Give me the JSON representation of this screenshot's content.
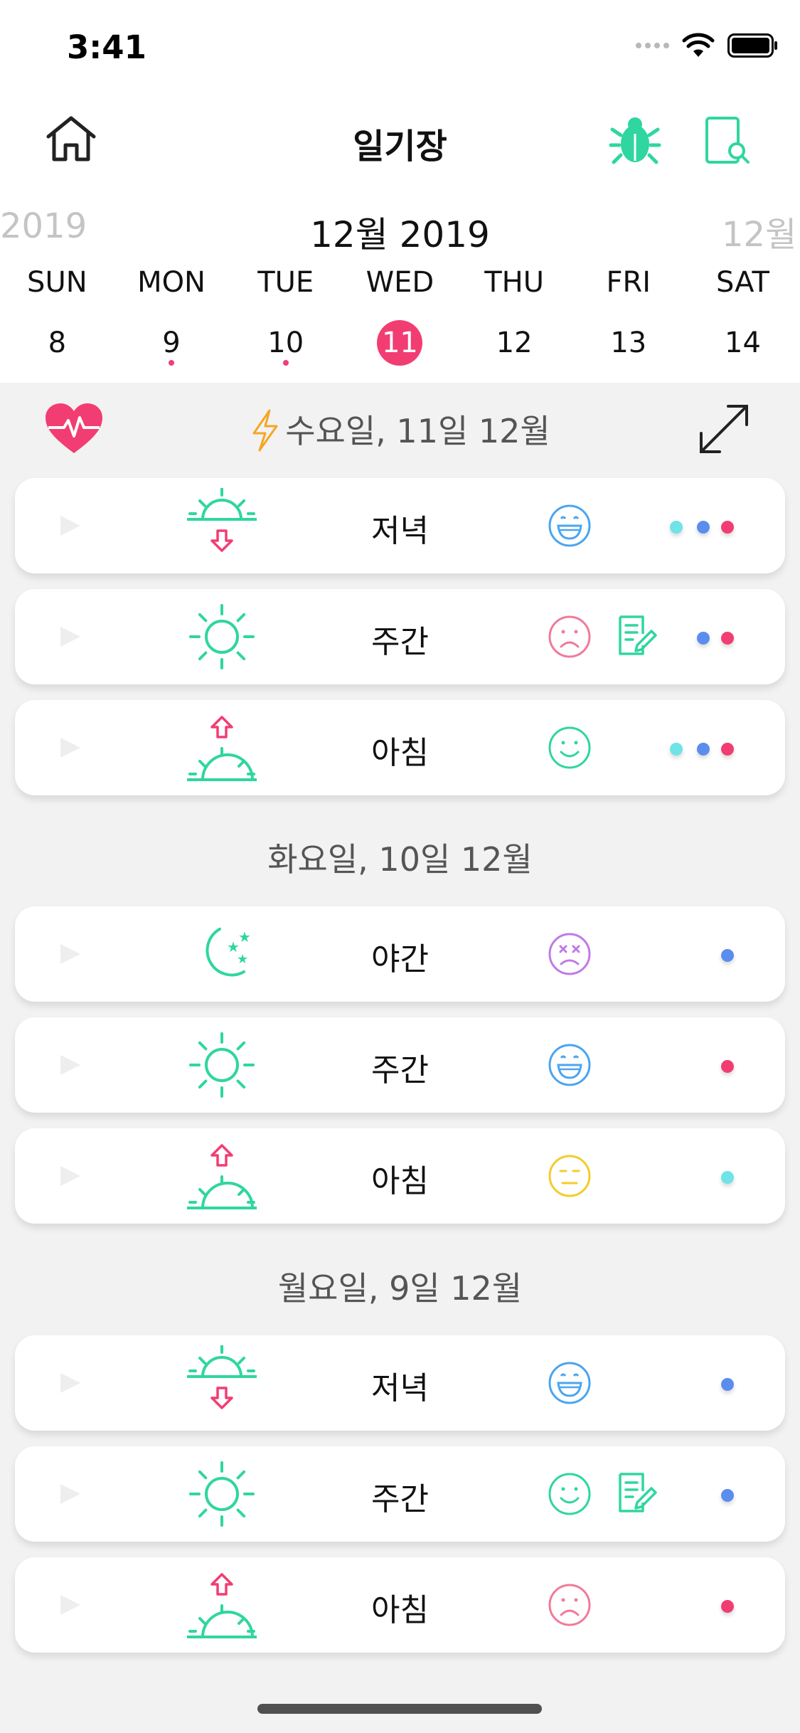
{
  "status_bar": {
    "time": "3:41"
  },
  "header": {
    "title": "일기장"
  },
  "calendar": {
    "prev_month": "2019",
    "current_month": "12월 2019",
    "next_month": "12월",
    "days": [
      {
        "name": "SUN",
        "date": "8",
        "selected": false,
        "has_entries": false
      },
      {
        "name": "MON",
        "date": "9",
        "selected": false,
        "has_entries": true
      },
      {
        "name": "TUE",
        "date": "10",
        "selected": false,
        "has_entries": true
      },
      {
        "name": "WED",
        "date": "11",
        "selected": true,
        "has_entries": true
      },
      {
        "name": "THU",
        "date": "12",
        "selected": false,
        "has_entries": false
      },
      {
        "name": "FRI",
        "date": "13",
        "selected": false,
        "has_entries": false
      },
      {
        "name": "SAT",
        "date": "14",
        "selected": false,
        "has_entries": false
      }
    ]
  },
  "colors": {
    "accent": "#f23d72",
    "teal": "#2fd6a0",
    "cyan": "#6fe3e8",
    "blue": "#5b8def",
    "pink": "#f23d72",
    "mood_blue": "#4aa5f0",
    "mood_red": "#f27a9a",
    "mood_green": "#2fd6a0",
    "mood_purple": "#c07ae8",
    "mood_yellow": "#f5cc2a"
  },
  "sections": [
    {
      "header": "수요일, 11일 12월",
      "entries": [
        {
          "period": "evening",
          "label": "저녁",
          "mood": "grin",
          "has_note": false,
          "dots": [
            "cyan",
            "blue",
            "pink"
          ]
        },
        {
          "period": "day",
          "label": "주간",
          "mood": "sad",
          "has_note": true,
          "dots": [
            "blue",
            "pink"
          ]
        },
        {
          "period": "morning",
          "label": "아침",
          "mood": "smile",
          "has_note": false,
          "dots": [
            "cyan",
            "blue",
            "pink"
          ]
        }
      ]
    },
    {
      "header": "화요일, 10일 12월",
      "entries": [
        {
          "period": "night",
          "label": "야간",
          "mood": "dizzy",
          "has_note": false,
          "dots": [
            "blue"
          ]
        },
        {
          "period": "day",
          "label": "주간",
          "mood": "grin",
          "has_note": false,
          "dots": [
            "pink"
          ]
        },
        {
          "period": "morning",
          "label": "아침",
          "mood": "neutral",
          "has_note": false,
          "dots": [
            "cyan"
          ]
        }
      ]
    },
    {
      "header": "월요일, 9일 12월",
      "entries": [
        {
          "period": "evening",
          "label": "저녁",
          "mood": "grin",
          "has_note": false,
          "dots": [
            "blue"
          ]
        },
        {
          "period": "day",
          "label": "주간",
          "mood": "smile",
          "has_note": true,
          "dots": [
            "blue"
          ]
        },
        {
          "period": "morning",
          "label": "아침",
          "mood": "sad",
          "has_note": false,
          "dots": [
            "pink"
          ]
        }
      ]
    }
  ]
}
